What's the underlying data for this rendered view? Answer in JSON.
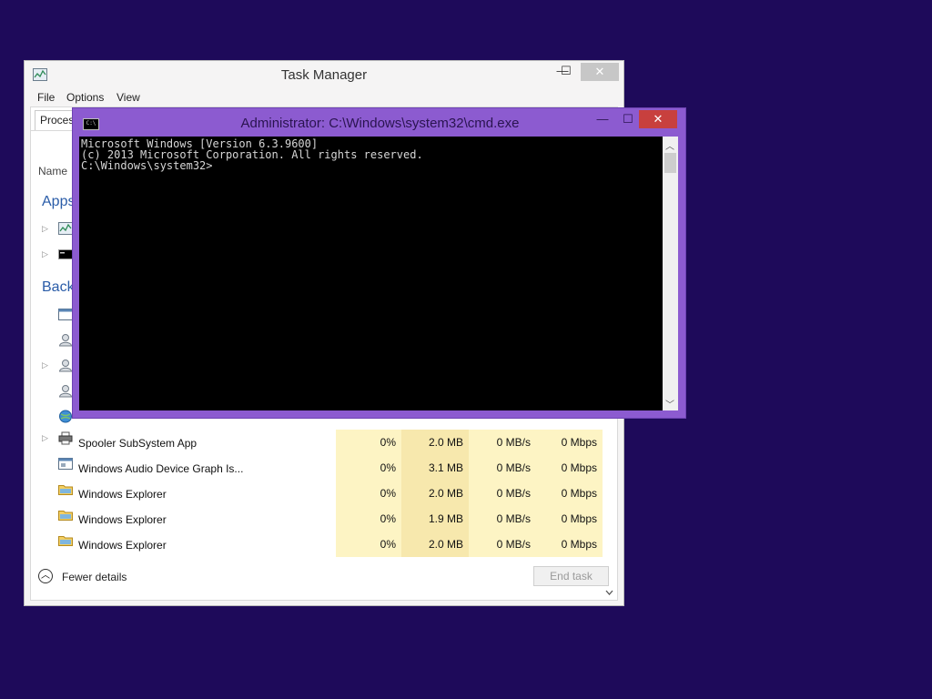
{
  "taskmanager": {
    "title": "Task Manager",
    "caption": {
      "minimize": "—",
      "maximize": "☐",
      "close": "✕"
    },
    "menu": [
      "File",
      "Options",
      "View"
    ],
    "tab_label": "Proces",
    "column_name": "Name",
    "sections": {
      "apps": "Apps",
      "background": "Back"
    },
    "rows": [
      {
        "name": "Spooler SubSystem App",
        "cpu": "0%",
        "memory": "2.0 MB",
        "disk": "0 MB/s",
        "network": "0 Mbps",
        "expandable": true,
        "icon": "printer-icon"
      },
      {
        "name": "Windows Audio Device Graph Is...",
        "cpu": "0%",
        "memory": "3.1 MB",
        "disk": "0 MB/s",
        "network": "0 Mbps",
        "expandable": false,
        "icon": "window-icon"
      },
      {
        "name": "Windows Explorer",
        "cpu": "0%",
        "memory": "2.0 MB",
        "disk": "0 MB/s",
        "network": "0 Mbps",
        "expandable": false,
        "icon": "folder-icon"
      },
      {
        "name": "Windows Explorer",
        "cpu": "0%",
        "memory": "1.9 MB",
        "disk": "0 MB/s",
        "network": "0 Mbps",
        "expandable": false,
        "icon": "folder-icon"
      },
      {
        "name": "Windows Explorer",
        "cpu": "0%",
        "memory": "2.0 MB",
        "disk": "0 MB/s",
        "network": "0 Mbps",
        "expandable": false,
        "icon": "folder-icon"
      }
    ],
    "fewer_details": "Fewer details",
    "end_task": "End task"
  },
  "cmd": {
    "title": "Administrator: C:\\Windows\\system32\\cmd.exe",
    "icon_text": "C:\\",
    "caption": {
      "minimize": "—",
      "maximize": "☐",
      "close": "✕"
    },
    "lines": [
      "Microsoft Windows [Version 6.3.9600]",
      "(c) 2013 Microsoft Corporation. All rights reserved.",
      "C:\\Windows\\system32>"
    ]
  },
  "colors": {
    "desktop": "#1e0a5a",
    "cmd_frame": "#8c5bd0",
    "close_red": "#c8403e",
    "accent_blue": "#2a5ca8"
  }
}
